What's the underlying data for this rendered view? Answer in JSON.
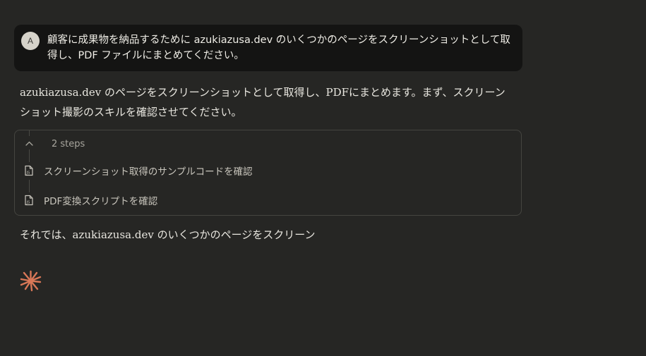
{
  "user_message": {
    "avatar_initial": "A",
    "text": "顧客に成果物を納品するために azukiazusa.dev のいくつかのページをスクリーンショットとして取得し、PDF ファイルにまとめてください。"
  },
  "assistant": {
    "intro": "azukiazusa.dev のページをスクリーンショットとして取得し、PDFにまとめます。まず、スクリーンショット撮影のスキルを確認させてください。",
    "steps": {
      "summary": "2 steps",
      "items": [
        {
          "label": "スクリーンショット取得のサンプルコードを確認",
          "icon": "js-file-icon"
        },
        {
          "label": "PDF変換スクリプトを確認",
          "icon": "js-file-icon"
        }
      ]
    },
    "followup": "それでは、azukiazusa.dev のいくつかのページをスクリーン"
  },
  "colors": {
    "background": "#262624",
    "user_bubble": "#141413",
    "accent_spark": "#d97757"
  },
  "icons": {
    "loading": "spark-icon"
  }
}
